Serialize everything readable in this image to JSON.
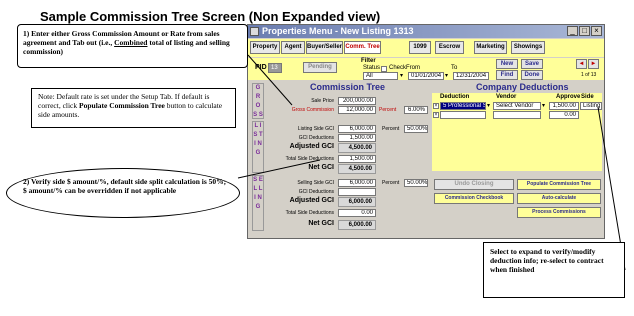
{
  "heading": "Sample Commission Tree Screen (Non Expanded view)",
  "window": {
    "title": "Properties Menu - New Listing 1313",
    "controls": [
      "_",
      "□",
      "×"
    ]
  },
  "tabs": [
    "Property",
    "Agent",
    "Buyer/Seller",
    "Comm. Tree",
    "1099",
    "Escrow",
    "Marketing",
    "Showings"
  ],
  "active_tab": "Comm. Tree",
  "pid": {
    "label": "PID",
    "value": "13",
    "status": "Pending"
  },
  "filter": {
    "label": "Filter",
    "status_label": "Status",
    "check_label": "Check",
    "from_label": "From",
    "to_label": "To",
    "status_value": "All",
    "from_value": "01/01/2004",
    "to_value": "12/31/2004"
  },
  "actions": {
    "new": "New",
    "save": "Save",
    "find": "Find",
    "done": "Done",
    "record": "1 of 13"
  },
  "commission_tree": {
    "title": "Commission Tree",
    "gross_side": "G R O S S",
    "sale_price_label": "Sale Price",
    "sale_price": "200,000.00",
    "gross_commission_label": "Gross Commission",
    "gross_commission": "12,000.00",
    "percent_label": "Percent",
    "gross_percent": "6.00%",
    "listing_side": "L I S T I N G",
    "listing_side_gci_label": "Listing Side GCI",
    "listing_side_gci": "6,000.00",
    "listing_percent": "50.00%",
    "gci_deductions_label": "GCI Deductions",
    "listing_gci_deductions": "1,500.00",
    "adjusted_gci_label": "Adjusted GCI",
    "listing_adjusted_gci": "4,500.00",
    "total_side_deductions_label": "Total Side Deductions",
    "listing_total_side_deductions": "1,500.00",
    "net_gci_label": "Net GCI",
    "listing_net_gci": "4,500.00",
    "selling_side": "S E L L I N G",
    "selling_side_gci_label": "Selling Side GCI",
    "selling_side_gci": "6,000.00",
    "selling_percent": "50.00%",
    "selling_gci_deductions_label": "GCI Deductions",
    "selling_gci_deductions": "",
    "selling_adjusted_gci": "6,000.00",
    "selling_total_side_deductions": "0.00",
    "selling_net_gci": "6,000.00"
  },
  "company_deductions": {
    "title": "Company Deductions",
    "headers": [
      "Deduction",
      "Vendor",
      "Approve",
      "Side"
    ],
    "row": {
      "deduction": "5 Professional Ser",
      "vendor": "Select Vendor",
      "amount": "1,500.00",
      "side": "Listing"
    },
    "blank_amount": "0.00"
  },
  "buttons": {
    "undo_closing": "Undo Closing",
    "populate_commission_tree": "Populate Commission Tree",
    "commission_checkbook": "Commission Checkbook",
    "auto_calculate": "Auto-calculate",
    "process_commissions": "Process Commissions"
  },
  "callouts": {
    "c1_num": "1)",
    "c1_pre": "Enter either Gross Commission Amount or Rate from sales agreement and Tab out (i.e.,",
    "c1_underline": "Combined",
    "c1_post": "total of listing and selling commission)",
    "note_label": "Note:",
    "note_pre": "Default rate is set under the Setup Tab.  If default is correct, click",
    "note_bold": "Populate Commission Tree",
    "note_post": "button to calculate side amounts.",
    "c2": "2) Verify side $ amount/%, default side split calculation is 50%; $ amount/% can be overridden if not applicable",
    "c3": "Select to expand to verify/modify deduction info; re-select to contract when finished"
  }
}
